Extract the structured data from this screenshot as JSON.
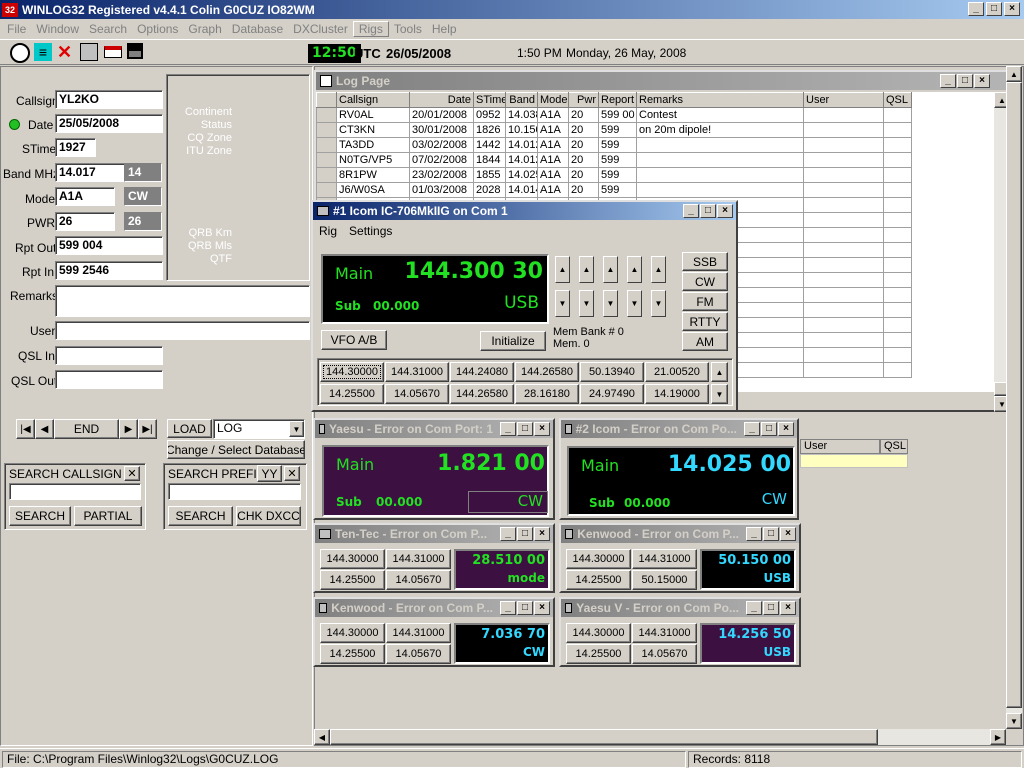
{
  "app": {
    "title": "WINLOG32 Registered  v4.4.1       Colin     G0CUZ   IO82WM",
    "icon_label": "32"
  },
  "menu": [
    "File",
    "Window",
    "Search",
    "Options",
    "Graph",
    "Database",
    "DXCluster",
    "Rigs",
    "Tools",
    "Help"
  ],
  "toolbar": {
    "clock_time": "12:50",
    "utc_label": "UTC",
    "utc_date": "26/05/2008",
    "local_time": "1:50 PM",
    "local_date": "Monday, 26 May, 2008"
  },
  "entry": {
    "callsign_label": "Callsign",
    "callsign": "YL2KO",
    "date_label": "Date",
    "date": "25/05/2008",
    "stime_label": "STime",
    "stime": "1927",
    "band_label": "Band MHz",
    "band": "14.017",
    "band_short": "14",
    "mode_label": "Mode",
    "mode": "A1A",
    "mode_short": "CW",
    "pwr_label": "PWR",
    "pwr": "26",
    "pwr_short": "26",
    "rptout_label": "Rpt Out",
    "rptout": "599 004",
    "rptin_label": "Rpt In",
    "rptin": "599 2546",
    "remarks_label": "Remarks",
    "remarks": "",
    "user_label": "User",
    "user": "",
    "qslin_label": "QSL In",
    "qslin": "",
    "qslout_label": "QSL Out",
    "qslout": ""
  },
  "info": {
    "continent": "Continent",
    "status": "Status",
    "cq_zone": "CQ Zone",
    "itu_zone": "ITU Zone",
    "qrb_km": "QRB Km",
    "qrb_mls": "QRB Mls",
    "qtf": "QTF"
  },
  "nav": {
    "end_label": "END",
    "load_label": "LOAD",
    "db_select": "LOG",
    "change_db_label": "Change / Select Database"
  },
  "search_callsign": {
    "title": "SEARCH CALLSIGN",
    "value": "",
    "search": "SEARCH",
    "partial": "PARTIAL"
  },
  "search_prefix": {
    "title": "SEARCH PREFIX",
    "yy": "YY",
    "value": "",
    "search": "SEARCH",
    "chk": "CHK DXCC"
  },
  "logpage": {
    "title": "Log Page",
    "columns": [
      "Callsign",
      "Date",
      "STime",
      "Band",
      "Mode",
      "Pwr",
      "Report",
      "Remarks",
      "User",
      "QSL"
    ],
    "rows": [
      [
        "RV0AL",
        "20/01/2008",
        "0952",
        "14.038",
        "A1A",
        "20",
        "599 00",
        "Contest",
        "",
        ""
      ],
      [
        "CT3KN",
        "30/01/2008",
        "1826",
        "10.150",
        "A1A",
        "20",
        "599",
        "on 20m dipole!",
        "",
        ""
      ],
      [
        "TA3DD",
        "03/02/2008",
        "1442",
        "14.012",
        "A1A",
        "20",
        "599",
        "",
        "",
        ""
      ],
      [
        "N0TG/VP5",
        "07/02/2008",
        "1844",
        "14.012",
        "A1A",
        "20",
        "599",
        "",
        "",
        ""
      ],
      [
        "8R1PW",
        "23/02/2008",
        "1855",
        "14.025",
        "A1A",
        "20",
        "599",
        "",
        "",
        ""
      ],
      [
        "J6/W0SA",
        "01/03/2008",
        "2028",
        "14.014",
        "A1A",
        "20",
        "599",
        "",
        "",
        ""
      ]
    ],
    "lower_columns": [
      "User",
      "QSL"
    ]
  },
  "rig1": {
    "title": "#1 Icom IC-706MkIIG on Com 1",
    "menu": [
      "Rig",
      "Settings"
    ],
    "main_label": "Main",
    "main_freq": "144.300 30",
    "sub_label": "Sub",
    "sub_freq": "00.000",
    "mode": "USB",
    "vfo": "VFO A/B",
    "init": "Initialize",
    "membank": "Mem Bank # 0",
    "mem": "Mem. 0",
    "modes": [
      "SSB",
      "CW",
      "FM",
      "RTTY",
      "AM"
    ],
    "mem_row1": [
      "144.30000",
      "144.31000",
      "144.24080",
      "144.26580",
      "50.13940",
      "21.00520"
    ],
    "mem_row2": [
      "14.25500",
      "14.05670",
      "144.26580",
      "28.16180",
      "24.97490",
      "14.19000"
    ]
  },
  "yaesu": {
    "title": "Yaesu - Error on Com Port: 1",
    "main_label": "Main",
    "main_freq": "1.821 00",
    "sub_label": "Sub",
    "sub_freq": "00.000",
    "mode": "CW"
  },
  "icom2": {
    "title": "#2 Icom - Error on Com Po...",
    "main_label": "Main",
    "main_freq": "14.025 00",
    "sub_label": "Sub",
    "sub_freq": "00.000",
    "mode": "CW"
  },
  "tentec": {
    "title": "Ten-Tec - Error on Com P...",
    "mems": [
      "144.30000",
      "144.31000",
      "14.25500",
      "14.05670"
    ],
    "freq": "28.510 00",
    "mode": "mode"
  },
  "kenwood1": {
    "title": "Kenwood - Error on Com P...",
    "mems": [
      "144.30000",
      "144.31000",
      "14.25500",
      "50.15000"
    ],
    "freq": "50.150 00",
    "mode": "USB"
  },
  "kenwood2": {
    "title": "Kenwood - Error on Com P...",
    "mems": [
      "144.30000",
      "144.31000",
      "14.25500",
      "14.05670"
    ],
    "freq": "7.036 70",
    "mode": "CW"
  },
  "yaesu5": {
    "title": "Yaesu V - Error on Com Po...",
    "mems": [
      "144.30000",
      "144.31000",
      "14.25500",
      "14.05670"
    ],
    "freq": "14.256 50",
    "mode": "USB"
  },
  "status": {
    "file": "File: C:\\Program Files\\Winlog32\\Logs\\G0CUZ.LOG",
    "records": "Records: 8118"
  },
  "colors": {
    "lcd_green": "#22e022",
    "lcd_cyan": "#33d8ff",
    "lcd_purple": "#3c1040",
    "title_active": "#0a246a"
  }
}
